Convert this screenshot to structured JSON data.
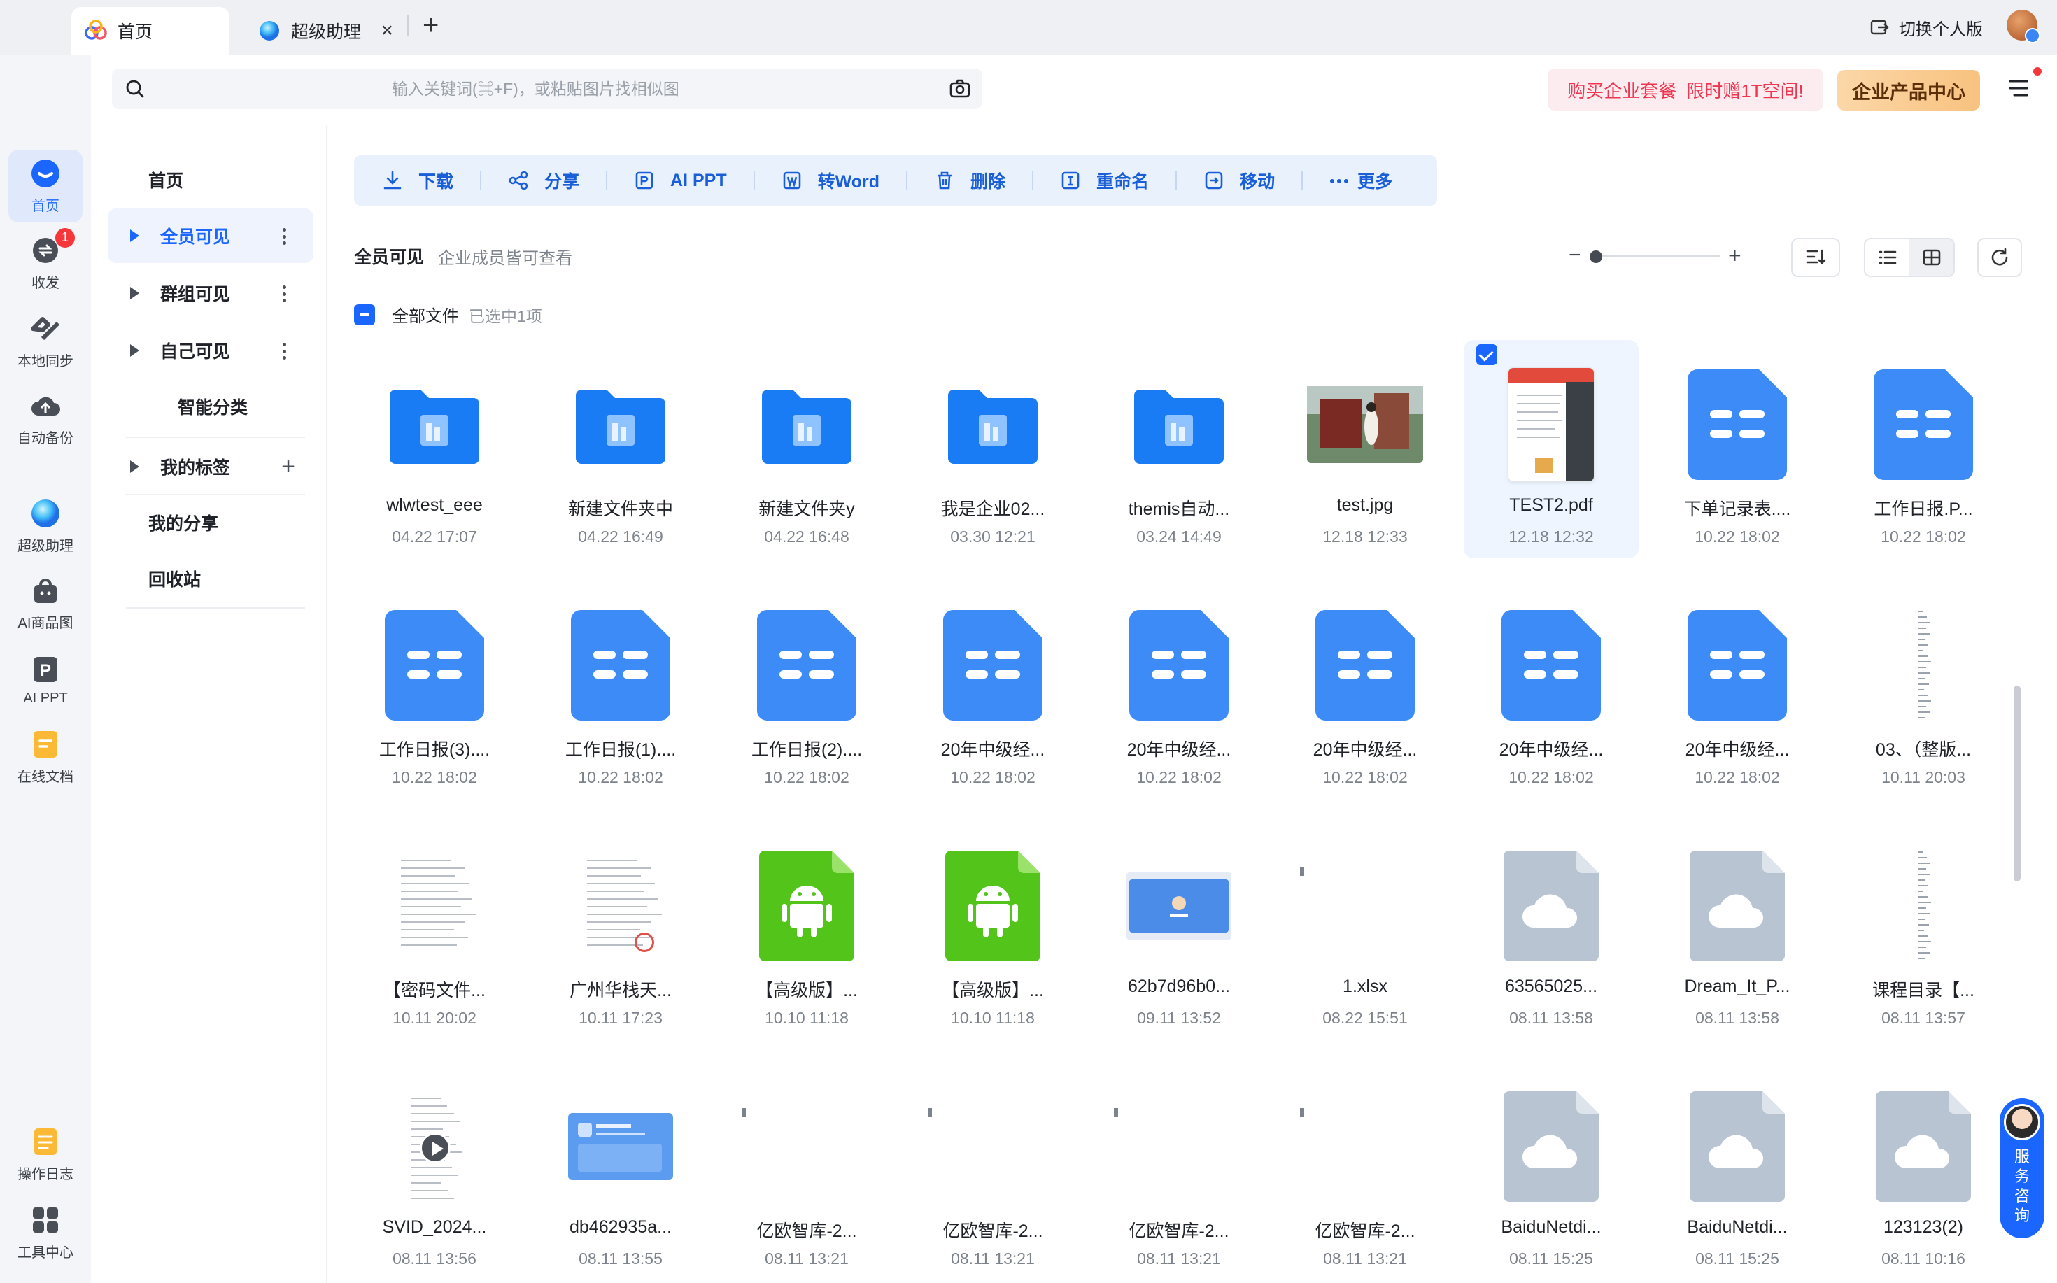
{
  "tabs": [
    {
      "label": "首页",
      "active": true
    },
    {
      "label": "超级助理",
      "active": false
    }
  ],
  "header": {
    "switch_label": "切换个人版",
    "search_placeholder": "输入关键词(⌘+F)，或粘贴图片找相似图",
    "promo_a": "购买企业套餐",
    "promo_b": "限时赠1T空间!",
    "enterprise_center": "企业产品中心"
  },
  "rail": [
    {
      "label": "首页",
      "icon": "home-icon",
      "active": true
    },
    {
      "label": "收发",
      "icon": "transfer-icon",
      "badge": "1"
    },
    {
      "label": "本地同步",
      "icon": "sync-icon"
    },
    {
      "label": "自动备份",
      "icon": "backup-icon"
    },
    {
      "label": "超级助理",
      "icon": "assistant-icon"
    },
    {
      "label": "AI商品图",
      "icon": "ai-product-icon"
    },
    {
      "label": "AI PPT",
      "icon": "ai-ppt-icon"
    },
    {
      "label": "在线文档",
      "icon": "online-doc-icon"
    },
    {
      "label": "操作日志",
      "icon": "log-icon"
    },
    {
      "label": "工具中心",
      "icon": "tools-icon"
    }
  ],
  "sidenav": {
    "home": "首页",
    "all_members": "全员可见",
    "group": "群组可见",
    "self": "自己可见",
    "smart": "智能分类",
    "tags": "我的标签",
    "shares": "我的分享",
    "trash": "回收站"
  },
  "toolbar": [
    {
      "label": "下载",
      "icon": "download-icon"
    },
    {
      "label": "分享",
      "icon": "share-icon"
    },
    {
      "label": "AI PPT",
      "icon": "ppt-icon"
    },
    {
      "label": "转Word",
      "icon": "word-icon"
    },
    {
      "label": "删除",
      "icon": "trash-icon"
    },
    {
      "label": "重命名",
      "icon": "rename-icon"
    },
    {
      "label": "移动",
      "icon": "move-icon"
    },
    {
      "label": "更多",
      "icon": "more-icon"
    }
  ],
  "section": {
    "title": "全员可见",
    "subtitle": "企业成员皆可查看",
    "all_files": "全部文件",
    "selected_count": "已选中1项"
  },
  "files": [
    {
      "name": "wlwtest_eee",
      "date": "04.22 17:07",
      "kind": "folder"
    },
    {
      "name": "新建文件夹中",
      "date": "04.22 16:49",
      "kind": "folder"
    },
    {
      "name": "新建文件夹y",
      "date": "04.22 16:48",
      "kind": "folder"
    },
    {
      "name": "我是企业02...",
      "date": "03.30 12:21",
      "kind": "folder"
    },
    {
      "name": "themis自动...",
      "date": "03.24 14:49",
      "kind": "folder"
    },
    {
      "name": "test.jpg",
      "date": "12.18 12:33",
      "kind": "photo"
    },
    {
      "name": "TEST2.pdf",
      "date": "12.18 12:32",
      "kind": "pdf",
      "selected": true
    },
    {
      "name": "下单记录表....",
      "date": "10.22 18:02",
      "kind": "sheet"
    },
    {
      "name": "工作日报.P...",
      "date": "10.22 18:02",
      "kind": "sheet"
    },
    {
      "name": "工作日报(3)....",
      "date": "10.22 18:02",
      "kind": "sheet"
    },
    {
      "name": "工作日报(1)....",
      "date": "10.22 18:02",
      "kind": "sheet"
    },
    {
      "name": "工作日报(2)....",
      "date": "10.22 18:02",
      "kind": "sheet"
    },
    {
      "name": "20年中级经...",
      "date": "10.22 18:02",
      "kind": "sheet"
    },
    {
      "name": "20年中级经...",
      "date": "10.22 18:02",
      "kind": "sheet"
    },
    {
      "name": "20年中级经...",
      "date": "10.22 18:02",
      "kind": "sheet"
    },
    {
      "name": "20年中级经...",
      "date": "10.22 18:02",
      "kind": "sheet"
    },
    {
      "name": "20年中级经...",
      "date": "10.22 18:02",
      "kind": "sheet"
    },
    {
      "name": "03、（整版...",
      "date": "10.11 20:03",
      "kind": "strip"
    },
    {
      "name": "【密码文件...",
      "date": "10.11 20:02",
      "kind": "doc"
    },
    {
      "name": "广州华栈天...",
      "date": "10.11 17:23",
      "kind": "doc-stamp"
    },
    {
      "name": "【高级版】...",
      "date": "10.10 11:18",
      "kind": "apk"
    },
    {
      "name": "【高级版】...",
      "date": "10.10 11:18",
      "kind": "apk"
    },
    {
      "name": "62b7d96b0...",
      "date": "09.11 13:52",
      "kind": "screen"
    },
    {
      "name": "1.xlsx",
      "date": "08.22 15:51",
      "kind": "tiny"
    },
    {
      "name": "63565025...",
      "date": "08.11 13:58",
      "kind": "cloud"
    },
    {
      "name": "Dream_It_P...",
      "date": "08.11 13:58",
      "kind": "cloud"
    },
    {
      "name": "课程目录【...",
      "date": "08.11 13:57",
      "kind": "strip"
    },
    {
      "name": "SVID_2024...",
      "date": "08.11 13:56",
      "kind": "video"
    },
    {
      "name": "db462935a...",
      "date": "08.11 13:55",
      "kind": "card"
    },
    {
      "name": "亿欧智库-2...",
      "date": "08.11 13:21",
      "kind": "tiny"
    },
    {
      "name": "亿欧智库-2...",
      "date": "08.11 13:21",
      "kind": "tiny"
    },
    {
      "name": "亿欧智库-2...",
      "date": "08.11 13:21",
      "kind": "tiny"
    },
    {
      "name": "亿欧智库-2...",
      "date": "08.11 13:21",
      "kind": "tiny"
    },
    {
      "name": "BaiduNetdi...",
      "date": "08.11 15:25",
      "kind": "cloud"
    },
    {
      "name": "BaiduNetdi...",
      "date": "08.11 15:25",
      "kind": "cloud"
    },
    {
      "name": "123123(2)",
      "date": "08.11 10:16",
      "kind": "cloud"
    }
  ],
  "service": {
    "label": "服务咨询"
  },
  "colors": {
    "primary": "#1a66ff",
    "folder": "#1a7cf5",
    "sheet": "#3d8bf7",
    "apk": "#52c41a",
    "cloud": "#b8c4d2"
  }
}
